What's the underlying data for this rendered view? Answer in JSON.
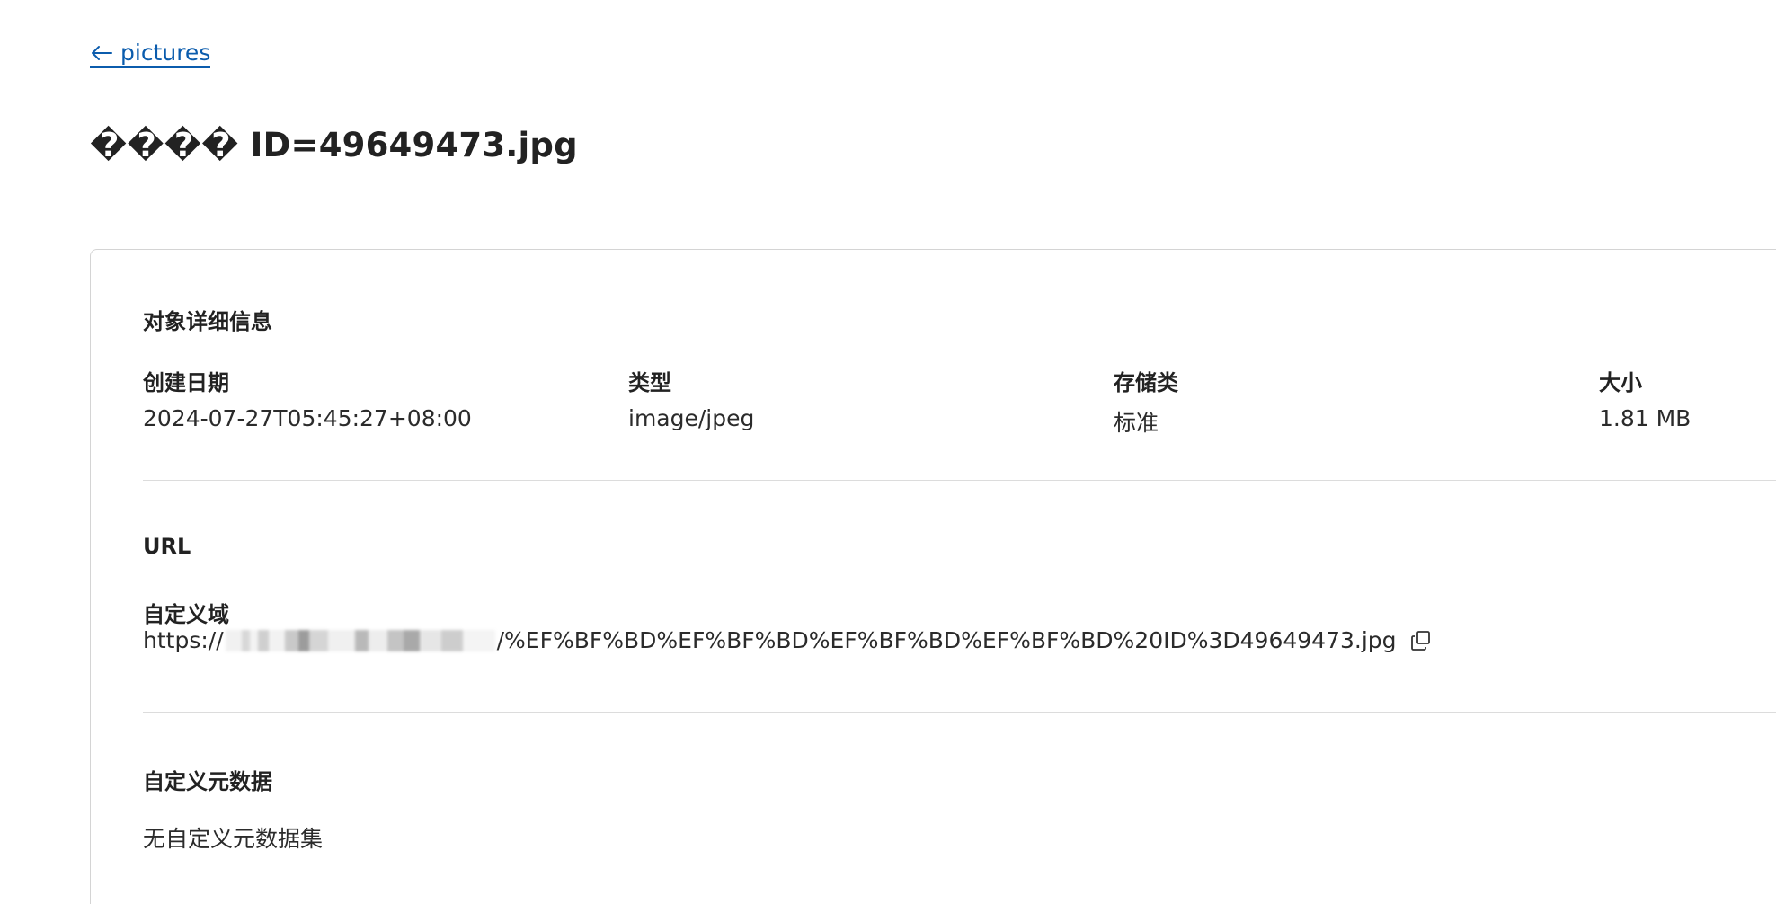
{
  "nav": {
    "back_label": "pictures"
  },
  "header": {
    "title": "���� ID=49649473.jpg"
  },
  "details": {
    "section_title": "对象详细信息",
    "fields": [
      {
        "label": "创建日期",
        "value": "2024-07-27T05:45:27+08:00"
      },
      {
        "label": "类型",
        "value": "image/jpeg"
      },
      {
        "label": "存储类",
        "value": "标准"
      },
      {
        "label": "大小",
        "value": "1.81 MB"
      }
    ]
  },
  "url_section": {
    "section_title": "URL",
    "custom_domain_label": "自定义域",
    "url_prefix": "https://",
    "url_suffix": "/%EF%BF%BD%EF%BF%BD%EF%BF%BD%EF%BF%BD%20ID%3D49649473.jpg",
    "copy_icon": "copy-icon"
  },
  "metadata_section": {
    "section_title": "自定义元数据",
    "empty_text": "无自定义元数据集"
  },
  "colors": {
    "link": "#0b5cad",
    "text": "#2b2b2b",
    "border": "#d4d4d4"
  }
}
